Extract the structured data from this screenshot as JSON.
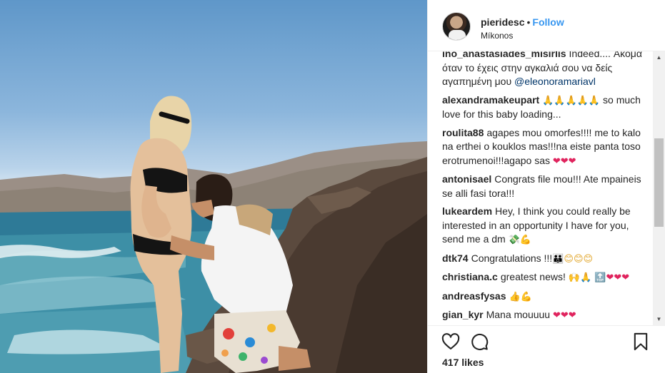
{
  "post": {
    "username": "pieridesc",
    "separator": "•",
    "follow_label": "Follow",
    "location": "Míkonos",
    "likes": "417 likes"
  },
  "comments": [
    {
      "user": "ino_anastasiades_misirlis",
      "text": "Indeed.... Ακόμα όταν το έχεις στην αγκαλιά σου να δείς αγαπημένη μου ",
      "mention": "@eleonoramariavl",
      "emoji": ""
    },
    {
      "user": "alexandramakeupart",
      "text": " so much love for this baby loading...",
      "mention": "",
      "emoji": "🙏🙏🙏🙏🙏"
    },
    {
      "user": "roulita88",
      "text": "agapes mou omorfes!!!! me to kalo na erthei o kouklos mas!!!na eiste panta toso erotrumenoi!!!agapo sas ",
      "mention": "",
      "emoji": "❤❤❤"
    },
    {
      "user": "antonisael",
      "text": "Congrats file mou!!! Ate mpaineis se alli fasi tora!!!",
      "mention": "",
      "emoji": ""
    },
    {
      "user": "lukeardem",
      "text": "Hey, I think you could really be interested in an opportunity I have for you, send me a dm ",
      "mention": "",
      "emoji": "💸💪"
    },
    {
      "user": "dtk74",
      "text": "Congratulations !!!",
      "mention": "",
      "emoji": "👪😊😊😊"
    },
    {
      "user": "christiana.c",
      "text": "greatest news! ",
      "mention": "",
      "emoji": "🙌🙏 🔝❤❤❤"
    },
    {
      "user": "andreasfysas",
      "text": "",
      "mention": "",
      "emoji": "👍💪"
    },
    {
      "user": "gian_kyr",
      "text": "Mana mouuuu ",
      "mention": "",
      "emoji": "❤❤❤"
    }
  ],
  "icons": {
    "like": "heart-icon",
    "comment": "comment-icon",
    "save": "bookmark-icon",
    "scroll_up": "arrow-up-icon",
    "scroll_down": "arrow-down-icon"
  },
  "colors": {
    "follow": "#3897f0",
    "mention": "#003569",
    "text": "#262626",
    "border": "#efefef"
  }
}
